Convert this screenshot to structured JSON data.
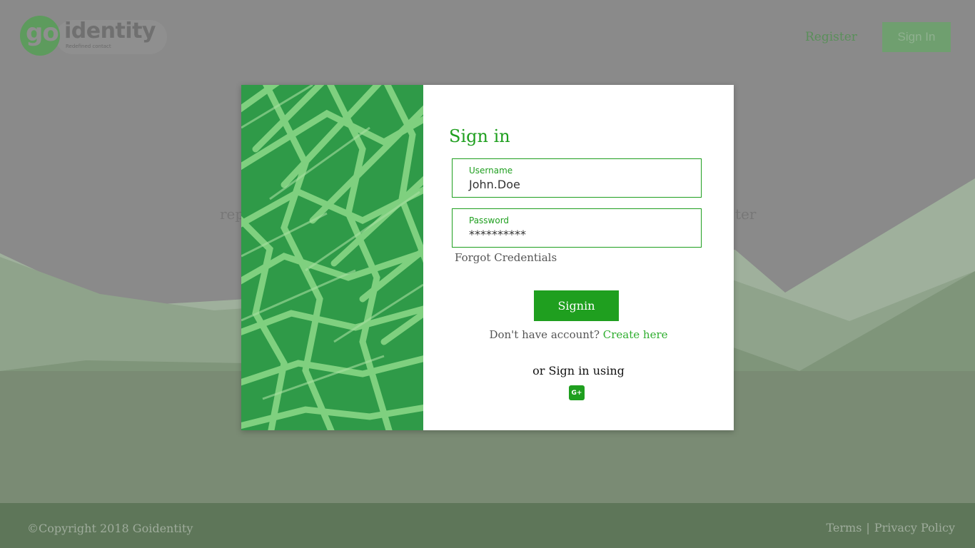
{
  "header": {
    "logo": {
      "go": "go",
      "name": "identity",
      "tagline": "Redefined contact"
    },
    "register_label": "Register",
    "signin_label": "Sign In"
  },
  "hero": {
    "left_fragment": "rep",
    "right_fragment": "ter"
  },
  "modal": {
    "title": "Sign in",
    "username": {
      "label": "Username",
      "value": "John.Doe"
    },
    "password": {
      "label": "Password",
      "value": "**********"
    },
    "forgot_label": "Forgot Credentials",
    "signin_button": "Signin",
    "no_account_text": "Don't have account?",
    "create_link": "Create here",
    "or_signin_text": "or Sign in using",
    "social": {
      "google_plus": "G+"
    }
  },
  "footer": {
    "copyright": "©Copyright 2018 Goidentity",
    "terms": "Terms",
    "separator": "|",
    "privacy": "Privacy Policy"
  },
  "colors": {
    "accent": "#1f9f1f",
    "overlay_gray": "#8a8a8a",
    "footer": "#5e7659"
  }
}
